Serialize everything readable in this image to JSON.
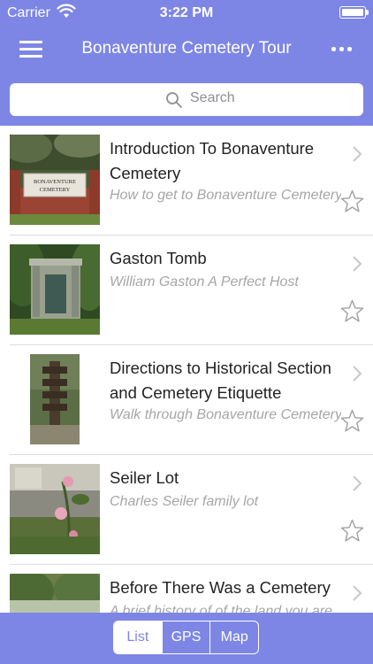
{
  "status_bar": {
    "carrier": "Carrier",
    "time": "3:22 PM"
  },
  "nav": {
    "title": "Bonaventure Cemetery Tour",
    "menu_icon": "hamburger-menu-icon",
    "more_icon": "more-dots-icon"
  },
  "search": {
    "placeholder": "Search"
  },
  "tour_items": [
    {
      "title": "Introduction To Bonaventure Cemetery",
      "subtitle": "How to get to Bonaventure Cemetery",
      "image_text": "BONAVENTURE CEMETERY"
    },
    {
      "title": "Gaston Tomb",
      "subtitle": "William Gaston A Perfect Host",
      "image_text": ""
    },
    {
      "title": "Directions to Historical Section and Cemetery Etiquette",
      "subtitle": "Walk through Bonaventure Cemetery to t",
      "image_text": ""
    },
    {
      "title": "Seiler Lot",
      "subtitle": "Charles Seiler family lot",
      "image_text": ""
    },
    {
      "title": "Before There Was a Cemetery",
      "subtitle": "A brief history of of the land you are",
      "image_text": ""
    }
  ],
  "bottom_tabs": {
    "list": "List",
    "gps": "GPS",
    "map": "Map",
    "active": "List"
  },
  "colors": {
    "accent": "#7d86e5",
    "subtitle": "#a6a6a6",
    "star": "#a0a0a0"
  }
}
